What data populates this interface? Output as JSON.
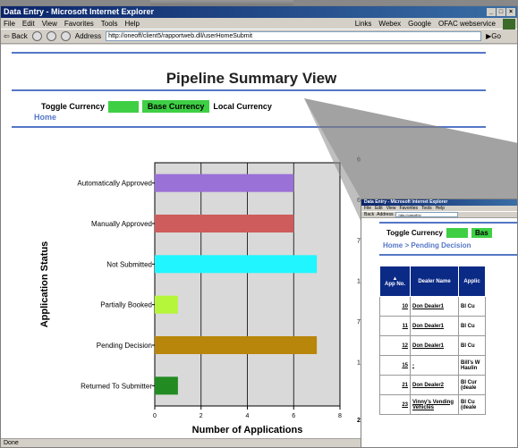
{
  "main_window": {
    "title": "Data Entry - Microsoft Internet Explorer",
    "menu": [
      "File",
      "Edit",
      "View",
      "Favorites",
      "Tools",
      "Help"
    ],
    "links": [
      "Links",
      "Webex",
      "Google",
      "OFAC webservice"
    ],
    "toolbar": {
      "back_label": "Back",
      "address_label": "Address",
      "url": "http://oneoff/client5/rapportweb.dll/userHomeSubmit",
      "go_label": "Go"
    },
    "status": "Done"
  },
  "page": {
    "title": "Pipeline Summary View",
    "toggle_label": "Toggle Currency",
    "base_currency": "Base Currency",
    "local_currency": "Local Currency",
    "home_link": "Home"
  },
  "chart_data": {
    "type": "bar",
    "orientation": "horizontal",
    "categories": [
      "Automatically Approved",
      "Manually Approved",
      "Not Submitted",
      "Partially Booked",
      "Pending Decision",
      "Returned To Submitter"
    ],
    "values": [
      6,
      6,
      7,
      1,
      7,
      1
    ],
    "value_labels": [
      "6",
      "6",
      "7",
      "1",
      "7",
      "1"
    ],
    "colors": [
      "#9a71d6",
      "#cf5c5c",
      "#1ff6ff",
      "#b5f53a",
      "#b8860b",
      "#228b22"
    ],
    "xlabel": "Number of Applications",
    "ylabel": "Application Status",
    "xlim": [
      0,
      8
    ],
    "x_ticks": [
      "0",
      "2",
      "4",
      "6",
      "8"
    ],
    "grid": true,
    "edge_label": "2"
  },
  "inset_window": {
    "title": "Data Entry - Microsoft Internet Explorer",
    "menu": [
      "File",
      "Edit",
      "View",
      "Favorites",
      "Tools",
      "Help"
    ],
    "toolbar": {
      "back_label": "Back",
      "address_label": "Address",
      "url": "http://oneoff/cl"
    },
    "toggle_label": "Toggle Currency",
    "base_currency": "Bas",
    "breadcrumb": "Home > Pending Decision",
    "table": {
      "headers": [
        "App No.",
        "Dealer Name",
        "Applic"
      ],
      "rows": [
        {
          "app_no": "10",
          "dealer": "Don Dealer1",
          "applicant": "Bl Cu"
        },
        {
          "app_no": "11",
          "dealer": "Don Dealer1",
          "applicant": "Bl Cu"
        },
        {
          "app_no": "12",
          "dealer": "Don Dealer1",
          "applicant": "Bl Cu"
        },
        {
          "app_no": "15",
          "dealer": "-",
          "applicant": "Bill's W Haulin"
        },
        {
          "app_no": "21",
          "dealer": "Don Dealer2",
          "applicant": "Bl Cur (deale"
        },
        {
          "app_no": "23",
          "dealer": "Vinny's Vending Vehicles",
          "applicant": "Bl Cu (deale"
        }
      ]
    }
  }
}
